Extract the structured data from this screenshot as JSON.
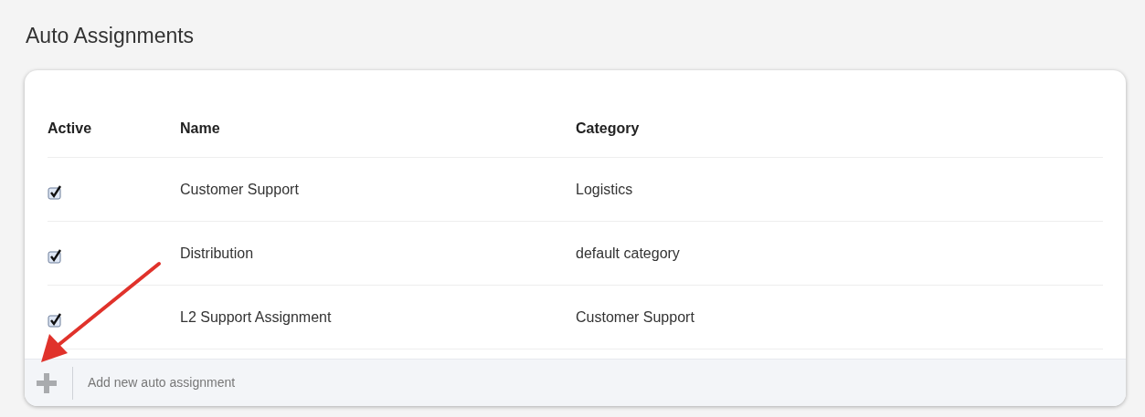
{
  "title": "Auto Assignments",
  "columns": [
    "Active",
    "Name",
    "Category"
  ],
  "rows": [
    {
      "checked": true,
      "name": "Customer Support",
      "category": "Logistics"
    },
    {
      "checked": true,
      "name": "Distribution",
      "category": "default category"
    },
    {
      "checked": true,
      "name": "L2 Support Assignment",
      "category": "Customer Support"
    }
  ],
  "add_label": "Add new auto assignment"
}
